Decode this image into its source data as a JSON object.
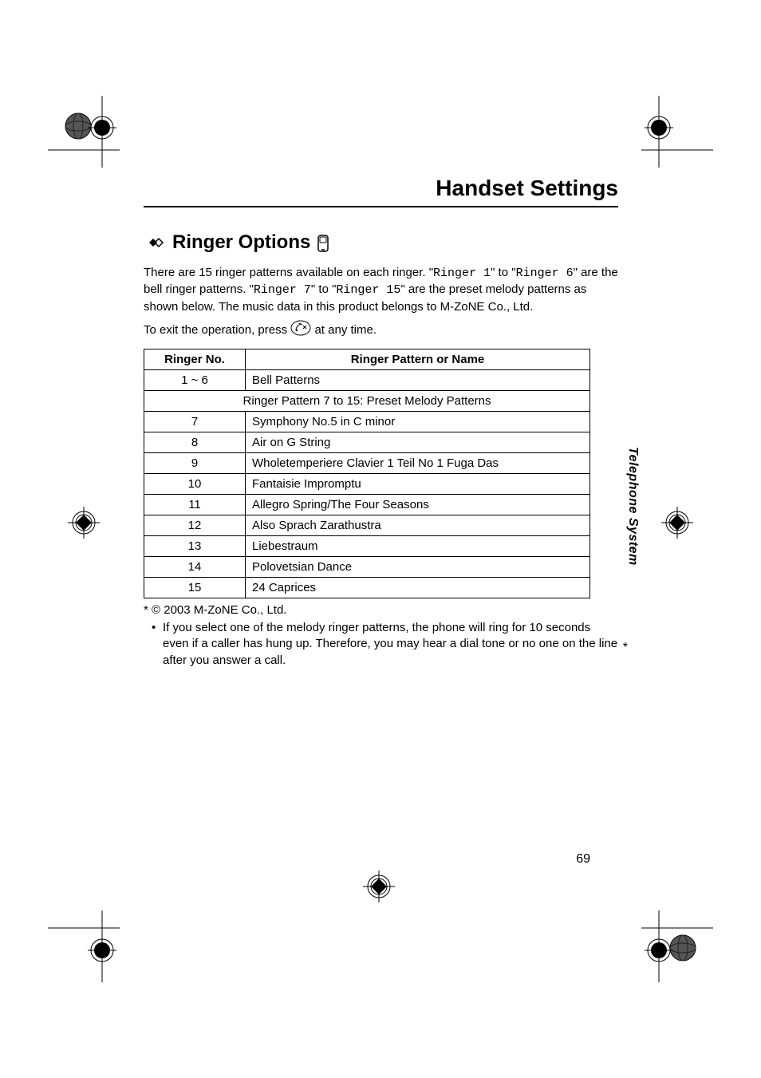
{
  "header": {
    "title": "Handset Settings"
  },
  "section": {
    "title": "Ringer Options",
    "intro_parts": {
      "t1": "There are 15 ringer patterns available on each ringer. \"",
      "m1": "Ringer 1",
      "t2": "\" to \"",
      "m2": "Ringer 6",
      "t3": "\" are the bell ringer patterns. \"",
      "m3": "Ringer 7",
      "t4": "\" to \"",
      "m4": "Ringer 15",
      "t5": "\" are the preset melody patterns as shown below. The music data in this product belongs to M-ZoNE Co., Ltd."
    },
    "exit_before": "To exit the operation, press ",
    "exit_after": " at any time."
  },
  "table": {
    "head_no": "Ringer No.",
    "head_name": "Ringer Pattern or Name",
    "row_1_no": "1 ~ 6",
    "row_1_name": "Bell Patterns",
    "span_row": "Ringer Pattern 7 to 15: Preset Melody Patterns",
    "rows": [
      {
        "no": "7",
        "name": "Symphony No.5 in C minor"
      },
      {
        "no": "8",
        "name": "Air on G String"
      },
      {
        "no": "9",
        "name": "Wholetemperiere Clavier 1 Teil No 1 Fuga Das"
      },
      {
        "no": "10",
        "name": "Fantaisie Impromptu"
      },
      {
        "no": "11",
        "name": "Allegro Spring/The Four Seasons"
      },
      {
        "no": "12",
        "name": "Also Sprach Zarathustra"
      },
      {
        "no": "13",
        "name": "Liebestraum"
      },
      {
        "no": "14",
        "name": "Polovetsian Dance"
      },
      {
        "no": "15",
        "name": "24 Caprices"
      }
    ],
    "asterisk": "*"
  },
  "footnotes": {
    "copyright": "* © 2003 M-ZoNE Co., Ltd.",
    "bullet": "If you select one of the melody ringer patterns, the phone will ring for 10 seconds even if a caller has hung up. Therefore, you may hear a dial tone or no one on the line after you answer a call."
  },
  "sidetab": "Telephone System",
  "page_number": "69"
}
